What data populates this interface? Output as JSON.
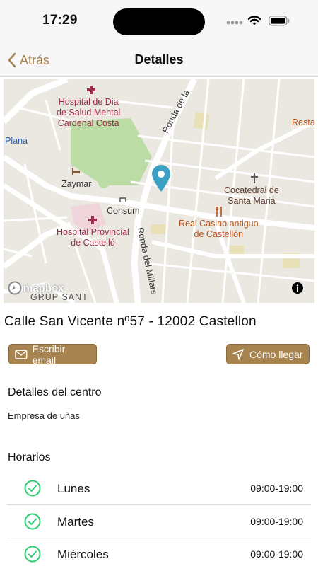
{
  "status": {
    "time": "17:29"
  },
  "nav": {
    "back_label": "Atrás",
    "title": "Detalles"
  },
  "map": {
    "labels": {
      "hospital_dia": "Hospital de Dia\nde Salud Mental\nCardenal Costa",
      "plana": "Plana",
      "zaymar": "Zaymar",
      "consum": "Consum",
      "hospital_provincial": "Hospital Provincial\nde Castelló",
      "ronda_la": "Ronda de la",
      "ronda_millars": "Ronda del Millars",
      "cocatedral": "Cocatedral de\nSanta Maria",
      "real_casino": "Real Casino antiguo\nde Castellón",
      "resta": "Resta",
      "grup_sant": "GRUP SANT",
      "mapbox": "mapbox"
    }
  },
  "address": "Calle San Vicente nº57 - 12002 Castellon",
  "actions": {
    "email_label": "Escribir email",
    "directions_label": "Cómo llegar"
  },
  "details": {
    "title": "Detalles del centro",
    "description": "Empresa de uñas"
  },
  "schedule": {
    "title": "Horarios",
    "rows": [
      {
        "day": "Lunes",
        "hours": "09:00-19:00"
      },
      {
        "day": "Martes",
        "hours": "09:00-19:00"
      },
      {
        "day": "Miércoles",
        "hours": "09:00-19:00"
      }
    ]
  },
  "colors": {
    "accent": "#a6834f",
    "check": "#2ecc71",
    "pin": "#3a9fc2",
    "poi_red": "#9b2c4a",
    "poi_orange": "#b5541c"
  }
}
